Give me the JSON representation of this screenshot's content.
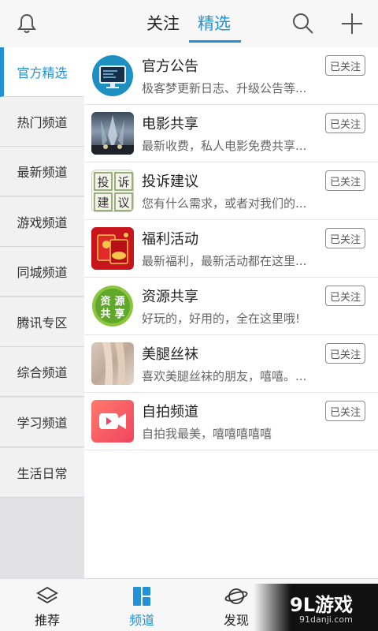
{
  "header": {
    "tabs": [
      {
        "label": "关注",
        "active": false
      },
      {
        "label": "精选",
        "active": true
      }
    ],
    "accent_color": "#2391d6"
  },
  "sidebar": {
    "items": [
      {
        "label": "官方精选",
        "active": true
      },
      {
        "label": "热门频道"
      },
      {
        "label": "最新频道"
      },
      {
        "label": "游戏频道"
      },
      {
        "label": "同城频道"
      },
      {
        "label": "腾讯专区"
      },
      {
        "label": "综合频道"
      },
      {
        "label": "学习频道"
      },
      {
        "label": "生活日常"
      }
    ]
  },
  "channels": [
    {
      "title": "官方公告",
      "desc": "极客梦更新日志、升级公告等...",
      "button": "已关注",
      "icon": "monitor-icon"
    },
    {
      "title": "电影共享",
      "desc": "最新收费，私人电影免费共享...",
      "button": "已关注",
      "icon": "movie-poster-thumbnail"
    },
    {
      "title": "投诉建议",
      "desc": "您有什么需求，或者对我们的...",
      "button": "已关注",
      "icon": "complaint-thumbnail"
    },
    {
      "title": "福利活动",
      "desc": "最新福利，最新活动都在这里...",
      "button": "已关注",
      "icon": "red-envelope-thumbnail"
    },
    {
      "title": "资源共享",
      "desc": "好玩的，好用的，全在这里哦!",
      "button": "已关注",
      "icon": "resource-share-thumbnail"
    },
    {
      "title": "美腿丝袜",
      "desc": "喜欢美腿丝袜的朋友，嘻嘻。...",
      "button": "已关注",
      "icon": "photo-thumbnail"
    },
    {
      "title": "自拍频道",
      "desc": "自拍我最美，嘻嘻嘻嘻嘻",
      "button": "已关注",
      "icon": "video-camera-icon"
    }
  ],
  "thumb_text": {
    "complaint": [
      "投",
      "诉",
      "建",
      "议"
    ],
    "resource": [
      "资",
      "源",
      "共",
      "享"
    ]
  },
  "bottom_nav": [
    {
      "label": "推荐",
      "icon": "layers-icon",
      "active": false
    },
    {
      "label": "频道",
      "icon": "grid-icon",
      "active": true
    },
    {
      "label": "发现",
      "icon": "planet-icon",
      "active": false
    }
  ],
  "watermark": {
    "text": "9L游戏",
    "url": "91danji.com"
  }
}
